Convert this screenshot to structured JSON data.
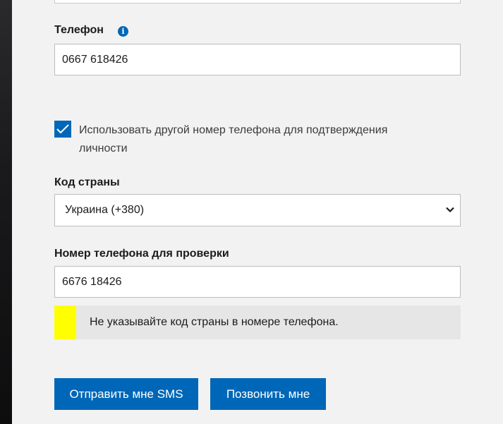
{
  "phone": {
    "label": "Телефон",
    "value": "0667 618426",
    "info_icon": "info-icon"
  },
  "alt_number": {
    "checked": true,
    "label": "Использовать другой номер телефона для подтверждения личности"
  },
  "country": {
    "label": "Код страны",
    "selected": "Украина (+380)"
  },
  "verify_phone": {
    "label": "Номер телефона для проверки",
    "value": "6676 18426"
  },
  "warning": {
    "text": "Не указывайте код страны в номере телефона.",
    "accent_color": "#ffff00"
  },
  "actions": {
    "send_sms": "Отправить мне SMS",
    "call_me": "Позвонить мне"
  },
  "colors": {
    "accent": "#0067b8",
    "panel_bg": "#f2f2f2"
  }
}
